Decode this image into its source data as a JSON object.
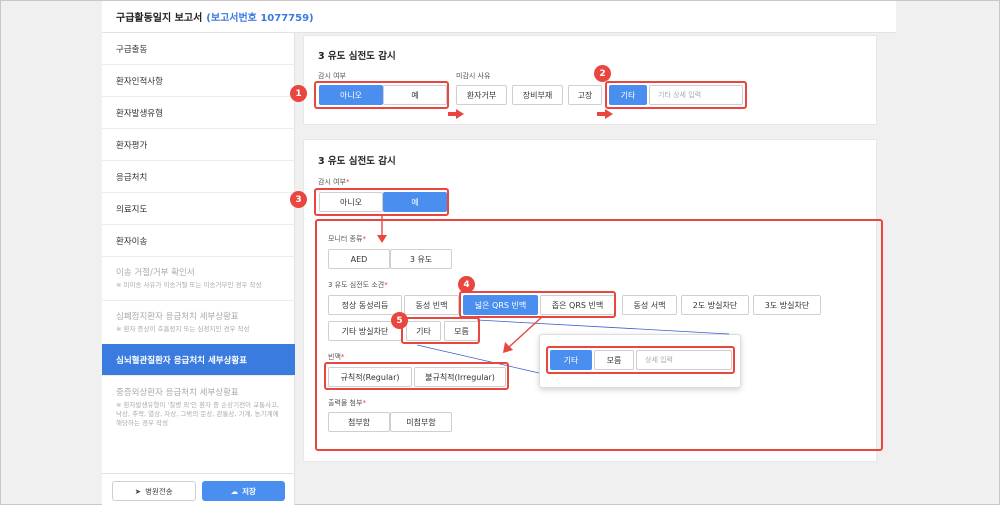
{
  "header": {
    "title": "구급활동일지 보고서",
    "report_number": "(보고서번호 1077759)"
  },
  "sidebar": {
    "items": [
      {
        "label": "구급출동",
        "sub": ""
      },
      {
        "label": "환자인적사항",
        "sub": ""
      },
      {
        "label": "환자발생유형",
        "sub": ""
      },
      {
        "label": "환자평가",
        "sub": ""
      },
      {
        "label": "응급처치",
        "sub": ""
      },
      {
        "label": "의료지도",
        "sub": ""
      },
      {
        "label": "환자이송",
        "sub": ""
      },
      {
        "label": "이송 거절/거부 확인서",
        "sub": "※ 미이송 사유가 이송거절 또는 이송거부인 경우 작성"
      },
      {
        "label": "심폐정지환자 응급처치 세부상황표",
        "sub": "※ 환자 증상이 호흡정지 또는 심정지인 경우 작성"
      },
      {
        "label": "심뇌혈관질환자 응급처치 세부상황표",
        "sub": ""
      },
      {
        "label": "중증외상환자 응급처치 세부상황표",
        "sub": "※ 환자발생유형이 '질병 외'인 환자 중 손상기전이 교통사고, 낙상, 추락, 열상, 자상, 그밖의 둔상, 관통상, 기계, 농기계에 해당하는 경우 작성"
      }
    ],
    "send_label": "병원전송",
    "save_label": "저장"
  },
  "card1": {
    "title": "3 유도 심전도 감시",
    "monitor_label": "감시 여부",
    "no_label": "아니오",
    "yes_label": "예",
    "reason_label": "미감시 사유",
    "reasons": [
      "환자거부",
      "장비부재",
      "고장",
      "기타"
    ],
    "other_placeholder": "기타 상세 입력"
  },
  "card2": {
    "title": "3 유도 심전도 감시",
    "monitor_label": "감시 여부",
    "no_label": "아니오",
    "yes_label": "예",
    "monitor_type_label": "모니터 종류",
    "monitor_types": [
      "AED",
      "3 유도"
    ],
    "findings_label": "3 유도 심전도 소견",
    "findings": [
      "정상 동성리듬",
      "동성 빈맥",
      "넓은 QRS 빈맥",
      "좁은 QRS 빈맥",
      "동성 서맥",
      "2도 방실차단",
      "3도 방실차단",
      "기타 방실차단",
      "기타",
      "모름"
    ],
    "rate_label": "빈맥",
    "rates": [
      "규칙적(Regular)",
      "불규칙적(Irregular)"
    ],
    "attach_label": "출력물 첨부",
    "attach": [
      "첨부함",
      "미첨부함"
    ]
  },
  "popup": {
    "other": "기타",
    "unknown": "모름",
    "placeholder": "상세 입력"
  },
  "badges": [
    "1",
    "2",
    "3",
    "4",
    "5"
  ],
  "colors": {
    "accent": "#4a8ef0",
    "highlight": "#e8463f",
    "active_nav": "#3a7be0"
  }
}
